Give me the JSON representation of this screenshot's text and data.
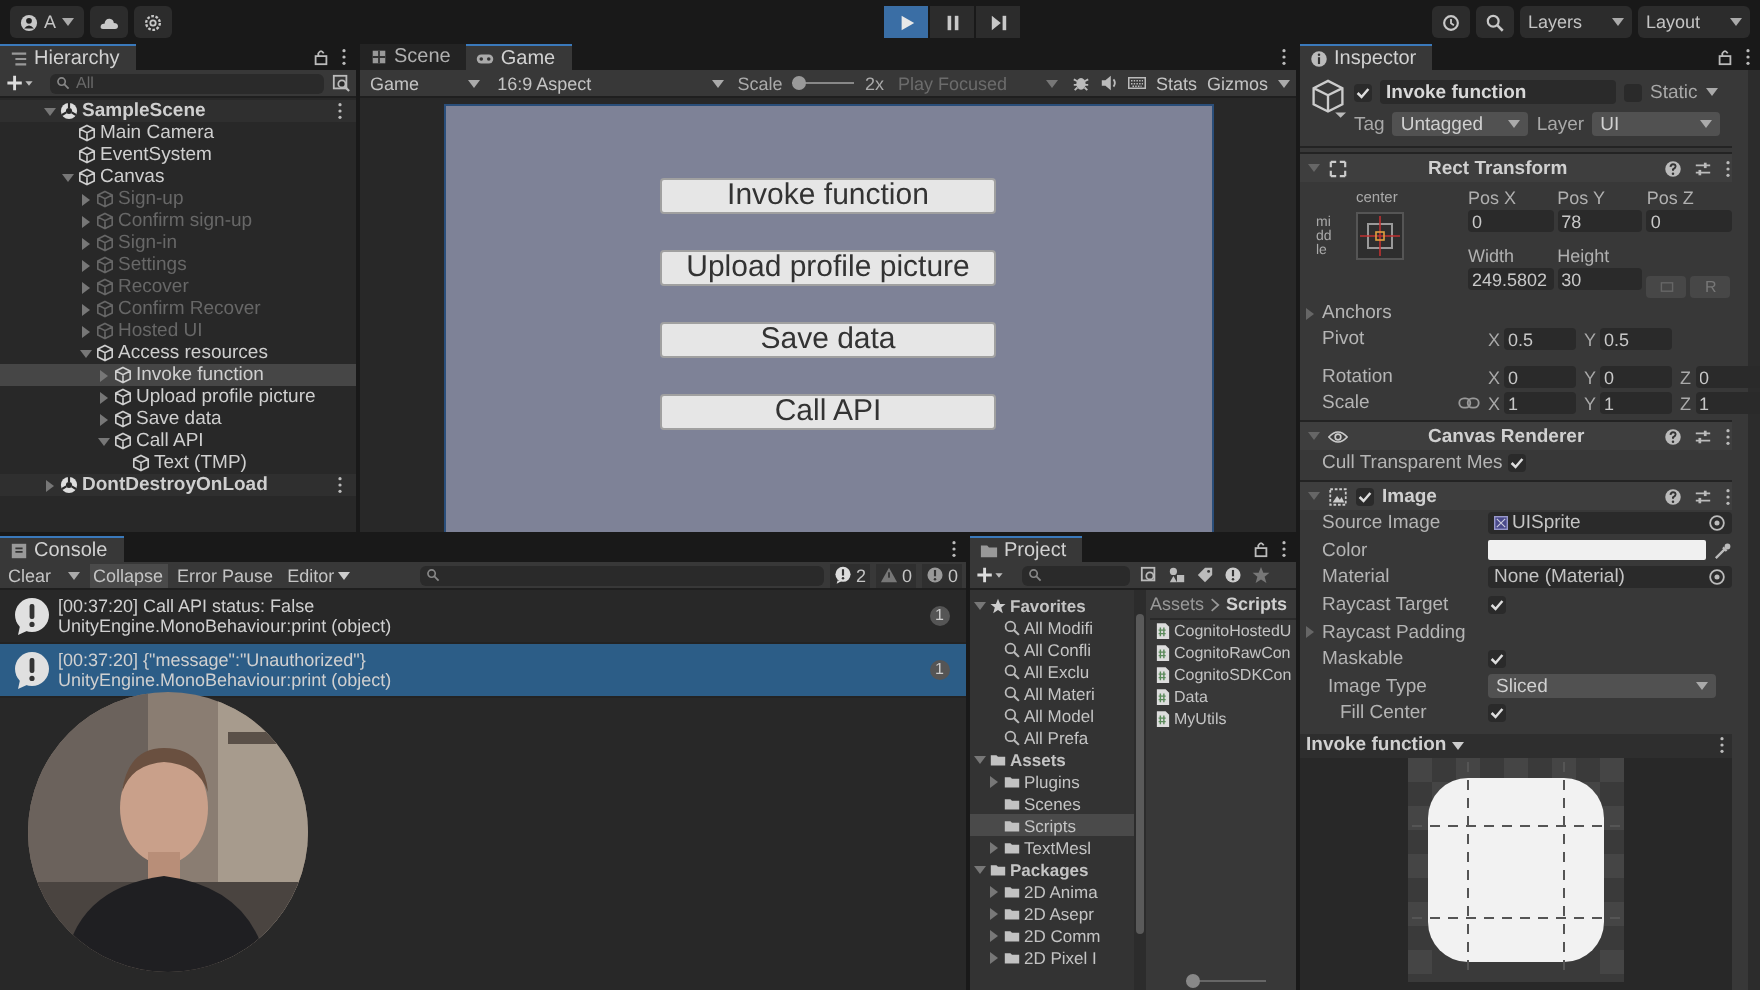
{
  "toolbar": {
    "account": "A",
    "playback": [
      {
        "kind": "play",
        "selected": true
      },
      {
        "kind": "pause",
        "selected": false
      },
      {
        "kind": "step",
        "selected": false
      }
    ],
    "layers": "Layers",
    "layout": "Layout"
  },
  "hierarchy": {
    "title": "Hierarchy",
    "search": {
      "placeholder": "All"
    },
    "items": [
      {
        "label": "SampleScene",
        "kind": "scene",
        "expanded": true,
        "selected": false,
        "disabled": false,
        "children": [
          {
            "label": "Main Camera",
            "kind": "object",
            "selected": false,
            "disabled": false
          },
          {
            "label": "EventSystem",
            "kind": "object",
            "selected": false,
            "disabled": false
          },
          {
            "label": "Canvas",
            "kind": "object",
            "expanded": true,
            "selected": false,
            "disabled": false,
            "children": [
              {
                "label": "Sign-up",
                "kind": "object",
                "expanded": false,
                "selected": false,
                "disabled": true
              },
              {
                "label": "Confirm sign-up",
                "kind": "object",
                "expanded": false,
                "selected": false,
                "disabled": true
              },
              {
                "label": "Sign-in",
                "kind": "object",
                "expanded": false,
                "selected": false,
                "disabled": true
              },
              {
                "label": "Settings",
                "kind": "object",
                "expanded": false,
                "selected": false,
                "disabled": true
              },
              {
                "label": "Recover",
                "kind": "object",
                "expanded": false,
                "selected": false,
                "disabled": true
              },
              {
                "label": "Confirm Recover",
                "kind": "object",
                "expanded": false,
                "selected": false,
                "disabled": true
              },
              {
                "label": "Hosted UI",
                "kind": "object",
                "expanded": false,
                "selected": false,
                "disabled": true
              },
              {
                "label": "Access resources",
                "kind": "object",
                "expanded": true,
                "selected": false,
                "disabled": false,
                "children": [
                  {
                    "label": "Invoke function",
                    "kind": "object",
                    "expanded": false,
                    "selected": true,
                    "disabled": false
                  },
                  {
                    "label": "Upload profile picture",
                    "kind": "object",
                    "expanded": false,
                    "selected": false,
                    "disabled": false
                  },
                  {
                    "label": "Save data",
                    "kind": "object",
                    "expanded": false,
                    "selected": false,
                    "disabled": false
                  },
                  {
                    "label": "Call API",
                    "kind": "object",
                    "expanded": true,
                    "selected": false,
                    "disabled": false,
                    "children": [
                      {
                        "label": "Text (TMP)",
                        "kind": "object",
                        "selected": false,
                        "disabled": false
                      }
                    ]
                  }
                ]
              }
            ]
          }
        ]
      },
      {
        "label": "DontDestroyOnLoad",
        "kind": "scene",
        "expanded": false,
        "selected": false,
        "disabled": false
      }
    ]
  },
  "game_view": {
    "tabs": [
      {
        "label": "Scene",
        "kind": "scene",
        "selected": false
      },
      {
        "label": "Game",
        "kind": "game",
        "selected": true
      }
    ],
    "display": "Game",
    "aspect": "16:9 Aspect",
    "scale_label": "Scale",
    "scale": {
      "level": 0
    },
    "scale_value": "2x",
    "play_mode": "Play Focused",
    "stats": "Stats",
    "gizmos": "Gizmos",
    "buttons": [
      "Invoke function",
      "Upload profile picture",
      "Save data",
      "Call API"
    ]
  },
  "inspector": {
    "title": "Inspector",
    "object": {
      "active": true,
      "name": "Invoke function",
      "static": false,
      "static_label": "Static",
      "tag_label": "Tag",
      "tag": "Untagged",
      "layer_label": "Layer",
      "layer": "UI"
    },
    "rect_transform": {
      "title": "Rect Transform",
      "anchor_h": "center",
      "anchor_v": "middle",
      "fields": [
        {
          "label": "Pos X",
          "value": "0"
        },
        {
          "label": "Pos Y",
          "value": "78"
        },
        {
          "label": "Pos Z",
          "value": "0"
        },
        {
          "label": "Width",
          "value": "249.5802"
        },
        {
          "label": "Height",
          "value": "30"
        }
      ],
      "raw_button": "R",
      "anchors": "Anchors",
      "rows": [
        {
          "label": "Pivot",
          "parts": [
            {
              "axis": "X",
              "value": "0.5"
            },
            {
              "axis": "Y",
              "value": "0.5"
            }
          ]
        },
        {
          "label": "Rotation",
          "parts": [
            {
              "axis": "X",
              "value": "0"
            },
            {
              "axis": "Y",
              "value": "0"
            },
            {
              "axis": "Z",
              "value": "0"
            }
          ]
        },
        {
          "label": "Scale",
          "parts": [
            {
              "axis": "X",
              "value": "1"
            },
            {
              "axis": "Y",
              "value": "1"
            },
            {
              "axis": "Z",
              "value": "1"
            }
          ]
        }
      ]
    },
    "canvas_renderer": {
      "title": "Canvas Renderer",
      "label": "Cull Transparent Mes",
      "checked": true
    },
    "image": {
      "title": "Image",
      "enabled": true,
      "rows": [
        {
          "kind": "object",
          "label": "Source Image",
          "value": "UISprite"
        },
        {
          "kind": "color",
          "label": "Color",
          "color": "#f0f0f0"
        },
        {
          "kind": "object",
          "label": "Material",
          "value": "None (Material)"
        },
        {
          "kind": "check",
          "label": "Raycast Target",
          "checked": true
        },
        {
          "kind": "foldout",
          "label": "Raycast Padding"
        },
        {
          "kind": "check",
          "label": "Maskable",
          "checked": true
        },
        {
          "kind": "dropdown",
          "label": "Image Type",
          "value": "Sliced"
        },
        {
          "kind": "subcheck",
          "label": "Fill Center",
          "checked": true
        }
      ]
    },
    "preview": {
      "title": "Invoke function"
    }
  },
  "console": {
    "title": "Console",
    "buttons": [
      {
        "label": "Clear",
        "kind": "dropdown-split",
        "selected": false
      },
      {
        "label": "Collapse",
        "kind": "toggle",
        "selected": true
      },
      {
        "label": "Error Pause",
        "kind": "toggle",
        "selected": false
      },
      {
        "label": "Editor",
        "kind": "dropdown",
        "selected": false
      }
    ],
    "counts": [
      {
        "kind": "info",
        "value": "2"
      },
      {
        "kind": "warning",
        "value": "0"
      },
      {
        "kind": "error",
        "value": "0"
      }
    ],
    "entries": [
      {
        "message": "[00:37:20] Call API status: False",
        "source": "UnityEngine.MonoBehaviour:print (object)",
        "count": "1",
        "selected": false
      },
      {
        "message": "[00:37:20] {\"message\":\"Unauthorized\"}",
        "source": "UnityEngine.MonoBehaviour:print (object)",
        "count": "1",
        "selected": true
      }
    ]
  },
  "project": {
    "title": "Project",
    "tree": [
      {
        "label": "Favorites",
        "kind": "favorites",
        "expanded": true,
        "selected": false,
        "children": [
          {
            "label": "All Modifi",
            "kind": "search",
            "selected": false
          },
          {
            "label": "All Confli",
            "kind": "search",
            "selected": false
          },
          {
            "label": "All Exclu",
            "kind": "search",
            "selected": false
          },
          {
            "label": "All Materi",
            "kind": "search",
            "selected": false
          },
          {
            "label": "All Model",
            "kind": "search",
            "selected": false
          },
          {
            "label": "All Prefa",
            "kind": "search",
            "selected": false
          }
        ]
      },
      {
        "label": "Assets",
        "kind": "folder",
        "expanded": true,
        "selected": false,
        "children": [
          {
            "label": "Plugins",
            "kind": "folder",
            "expanded": false,
            "selected": false
          },
          {
            "label": "Scenes",
            "kind": "folder",
            "selected": false
          },
          {
            "label": "Scripts",
            "kind": "folder",
            "selected": true
          },
          {
            "label": "TextMesl",
            "kind": "folder",
            "expanded": false,
            "selected": false
          }
        ]
      },
      {
        "label": "Packages",
        "kind": "folder",
        "expanded": true,
        "selected": false,
        "children": [
          {
            "label": "2D Anima",
            "kind": "folder",
            "expanded": false,
            "selected": false
          },
          {
            "label": "2D Asepr",
            "kind": "folder",
            "expanded": false,
            "selected": false
          },
          {
            "label": "2D Comm",
            "kind": "folder",
            "expanded": false,
            "selected": false
          },
          {
            "label": "2D Pixel I",
            "kind": "folder",
            "expanded": false,
            "selected": false
          }
        ]
      }
    ],
    "breadcrumb": [
      "Assets",
      "Scripts"
    ],
    "files": [
      "CognitoHostedU",
      "CognitoRawCon",
      "CognitoSDKCon",
      "Data",
      "MyUtils"
    ],
    "icon_size": {
      "level": 0
    }
  }
}
